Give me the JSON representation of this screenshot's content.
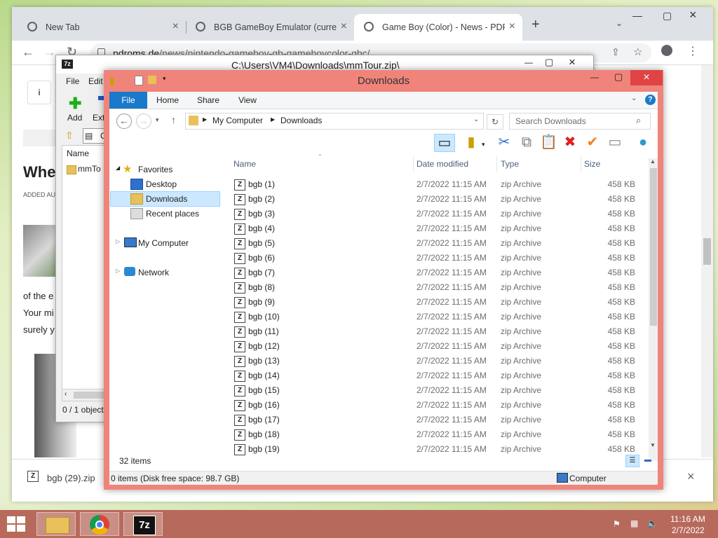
{
  "browser": {
    "tabs": [
      {
        "title": "New Tab"
      },
      {
        "title": "BGB GameBoy Emulator (current"
      },
      {
        "title": "Game Boy (Color) - News - PDRo"
      }
    ],
    "url_host": "pdroms.de",
    "url_path": "/news/nintendo-gameboy-gb-gameboycolor-gbc/",
    "page": {
      "heading_partial": "When",
      "added_partial": "ADDED AUG",
      "text1": "of the e",
      "text2": "Your mi",
      "text3": "surely y"
    },
    "download": {
      "filename": "bgb (29).zip"
    }
  },
  "sevenzip": {
    "title": "C:\\Users\\VM4\\Downloads\\mmTour.zip\\",
    "menu": [
      "File",
      "Edit"
    ],
    "toolbar": {
      "add": "Add",
      "extract": "Extr"
    },
    "path_partial": "C",
    "column_name": "Name",
    "item_partial": "mmTo",
    "status": "0 / 1 object"
  },
  "explorer": {
    "title": "Downloads",
    "ribbon_tabs": [
      "File",
      "Home",
      "Share",
      "View"
    ],
    "address": [
      "My Computer",
      "Downloads"
    ],
    "search_placeholder": "Search Downloads",
    "columns": {
      "name": "Name",
      "date": "Date modified",
      "type": "Type",
      "size": "Size"
    },
    "nav": {
      "favorites": "Favorites",
      "desktop": "Desktop",
      "downloads": "Downloads",
      "recent": "Recent places",
      "computer": "My Computer",
      "network": "Network"
    },
    "files": [
      {
        "name": "bgb (1)",
        "date": "2/7/2022 11:15 AM",
        "type": "zip Archive",
        "size": "458 KB"
      },
      {
        "name": "bgb (2)",
        "date": "2/7/2022 11:15 AM",
        "type": "zip Archive",
        "size": "458 KB"
      },
      {
        "name": "bgb (3)",
        "date": "2/7/2022 11:15 AM",
        "type": "zip Archive",
        "size": "458 KB"
      },
      {
        "name": "bgb (4)",
        "date": "2/7/2022 11:15 AM",
        "type": "zip Archive",
        "size": "458 KB"
      },
      {
        "name": "bgb (5)",
        "date": "2/7/2022 11:15 AM",
        "type": "zip Archive",
        "size": "458 KB"
      },
      {
        "name": "bgb (6)",
        "date": "2/7/2022 11:15 AM",
        "type": "zip Archive",
        "size": "458 KB"
      },
      {
        "name": "bgb (7)",
        "date": "2/7/2022 11:15 AM",
        "type": "zip Archive",
        "size": "458 KB"
      },
      {
        "name": "bgb (8)",
        "date": "2/7/2022 11:15 AM",
        "type": "zip Archive",
        "size": "458 KB"
      },
      {
        "name": "bgb (9)",
        "date": "2/7/2022 11:15 AM",
        "type": "zip Archive",
        "size": "458 KB"
      },
      {
        "name": "bgb (10)",
        "date": "2/7/2022 11:15 AM",
        "type": "zip Archive",
        "size": "458 KB"
      },
      {
        "name": "bgb (11)",
        "date": "2/7/2022 11:15 AM",
        "type": "zip Archive",
        "size": "458 KB"
      },
      {
        "name": "bgb (12)",
        "date": "2/7/2022 11:15 AM",
        "type": "zip Archive",
        "size": "458 KB"
      },
      {
        "name": "bgb (13)",
        "date": "2/7/2022 11:15 AM",
        "type": "zip Archive",
        "size": "458 KB"
      },
      {
        "name": "bgb (14)",
        "date": "2/7/2022 11:15 AM",
        "type": "zip Archive",
        "size": "458 KB"
      },
      {
        "name": "bgb (15)",
        "date": "2/7/2022 11:15 AM",
        "type": "zip Archive",
        "size": "458 KB"
      },
      {
        "name": "bgb (16)",
        "date": "2/7/2022 11:15 AM",
        "type": "zip Archive",
        "size": "458 KB"
      },
      {
        "name": "bgb (17)",
        "date": "2/7/2022 11:15 AM",
        "type": "zip Archive",
        "size": "458 KB"
      },
      {
        "name": "bgb (18)",
        "date": "2/7/2022 11:15 AM",
        "type": "zip Archive",
        "size": "458 KB"
      },
      {
        "name": "bgb (19)",
        "date": "2/7/2022 11:15 AM",
        "type": "zip Archive",
        "size": "458 KB"
      }
    ],
    "item_count": "32 items",
    "status_left": "0 items (Disk free space: 98.7 GB)",
    "status_right": "Computer"
  },
  "taskbar": {
    "time": "11:16 AM",
    "date": "2/7/2022"
  },
  "colors": {
    "explorer_frame": "#f0847a",
    "taskbar": "#b76a5c",
    "ribbon_file": "#1979ca",
    "selection": "#cce8ff"
  }
}
